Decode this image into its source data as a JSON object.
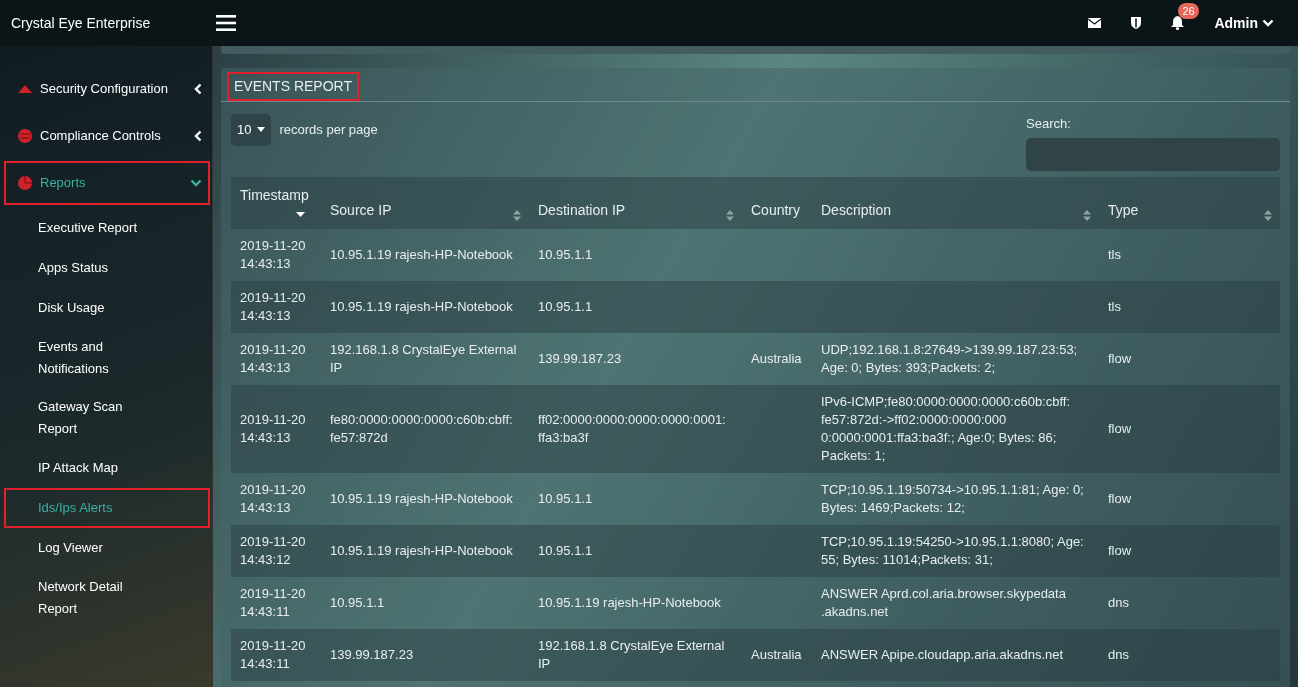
{
  "topbar": {
    "brand": "Crystal Eye Enterprise",
    "notification_count": "26",
    "user": "Admin"
  },
  "sidebar": {
    "items": [
      {
        "label": "Security Configuration",
        "expanded": false,
        "highlighted": false
      },
      {
        "label": "Compliance Controls",
        "expanded": false,
        "highlighted": false
      },
      {
        "label": "Reports",
        "expanded": true,
        "highlighted": true,
        "children": [
          {
            "label": "Executive Report",
            "selected": false,
            "highlighted": false
          },
          {
            "label": "Apps Status",
            "selected": false,
            "highlighted": false
          },
          {
            "label": "Disk Usage",
            "selected": false,
            "highlighted": false
          },
          {
            "label": "Events and Notifications",
            "selected": false,
            "highlighted": false
          },
          {
            "label": "Gateway Scan Report",
            "selected": false,
            "highlighted": false
          },
          {
            "label": "IP Attack Map",
            "selected": false,
            "highlighted": false
          },
          {
            "label": "Ids/Ips Alerts",
            "selected": true,
            "highlighted": true
          },
          {
            "label": "Log Viewer",
            "selected": false,
            "highlighted": false
          },
          {
            "label": "Network Detail Report",
            "selected": false,
            "highlighted": false
          }
        ]
      }
    ]
  },
  "panel": {
    "title": "EVENTS REPORT",
    "title_highlighted": true,
    "page_size": "10",
    "page_size_label": "records per page",
    "search_label": "Search:",
    "table": {
      "columns": [
        {
          "label": "Timestamp",
          "sorted": true
        },
        {
          "label": "Source IP",
          "sortable": true,
          "sorted": false
        },
        {
          "label": "Destination IP",
          "sortable": true,
          "sorted": false
        },
        {
          "label": "Country",
          "sortable": false
        },
        {
          "label": "Description",
          "sortable": true,
          "sorted": false
        },
        {
          "label": "Type",
          "sortable": true,
          "sorted": false
        }
      ],
      "rows": [
        [
          "2019-11-20 14:43:13",
          "10.95.1.19 rajesh-HP-Notebook",
          "10.95.1.1",
          "",
          "",
          "tls"
        ],
        [
          "2019-11-20 14:43:13",
          "10.95.1.19 rajesh-HP-Notebook",
          "10.95.1.1",
          "",
          "",
          "tls"
        ],
        [
          "2019-11-20 14:43:13",
          "192.168.1.8 CrystalEye External IP",
          "139.99.187.23",
          "Australia",
          "UDP;192.168.1.8:27649->139.99.187.23:53; Age: 0; Bytes: 393;Packets: 2;",
          "flow"
        ],
        [
          "2019-11-20 14:43:13",
          "fe80:0000:0000:0000:c60b:cbff: fe57:872d",
          "ff02:0000:0000:0000:0000:0001: ffa3:ba3f",
          "",
          "IPv6-ICMP;fe80:0000:0000:0000:c60b:cbff: fe57:872d:->ff02:0000:0000:000 0:0000:0001:ffa3:ba3f:; Age:0; Bytes: 86; Packets: 1;",
          "flow"
        ],
        [
          "2019-11-20 14:43:13",
          "10.95.1.19 rajesh-HP-Notebook",
          "10.95.1.1",
          "",
          "TCP;10.95.1.19:50734->10.95.1.1:81; Age: 0; Bytes: 1469;Packets: 12;",
          "flow"
        ],
        [
          "2019-11-20 14:43:12",
          "10.95.1.19 rajesh-HP-Notebook",
          "10.95.1.1",
          "",
          "TCP;10.95.1.19:54250->10.95.1.1:8080; Age: 55; Bytes: 11014;Packets: 31;",
          "flow"
        ],
        [
          "2019-11-20 14:43:11",
          "10.95.1.1",
          "10.95.1.19 rajesh-HP-Notebook",
          "",
          "ANSWER Aprd.col.aria.browser.skypedata .akadns.net",
          "dns"
        ],
        [
          "2019-11-20 14:43:11",
          "139.99.187.23",
          "192.168.1.8 CrystalEye External IP",
          "Australia",
          "ANSWER Apipe.cloudapp.aria.akadns.net",
          "dns"
        ]
      ]
    }
  }
}
